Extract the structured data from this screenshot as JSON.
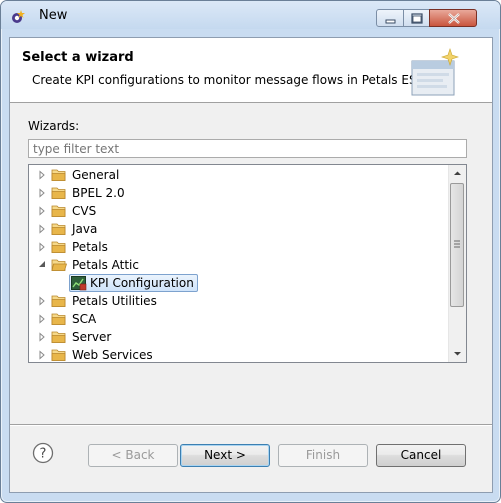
{
  "window": {
    "title": "New"
  },
  "banner": {
    "title": "Select a wizard",
    "description": "Create KPI configurations to monitor message flows in Petals ESB"
  },
  "wizards": {
    "label": "Wizards:",
    "filter_placeholder": "type filter text",
    "filter_value": ""
  },
  "tree": {
    "items": [
      {
        "label": "General",
        "expanded": false
      },
      {
        "label": "BPEL 2.0",
        "expanded": false
      },
      {
        "label": "CVS",
        "expanded": false
      },
      {
        "label": "Java",
        "expanded": false
      },
      {
        "label": "Petals",
        "expanded": false
      },
      {
        "label": "Petals Attic",
        "expanded": true
      },
      {
        "label": "KPI Configuration",
        "child": true,
        "selected": true
      },
      {
        "label": "Petals Utilities",
        "expanded": false
      },
      {
        "label": "SCA",
        "expanded": false
      },
      {
        "label": "Server",
        "expanded": false
      },
      {
        "label": "Web Services",
        "expanded": false
      }
    ]
  },
  "buttons": {
    "back": "< Back",
    "next": "Next >",
    "finish": "Finish",
    "cancel": "Cancel"
  },
  "colors": {
    "folder": "#e8b64a",
    "selection": "#cfe4fa",
    "selection_border": "#7da2ce",
    "title_bar": "#c5d9ef"
  }
}
